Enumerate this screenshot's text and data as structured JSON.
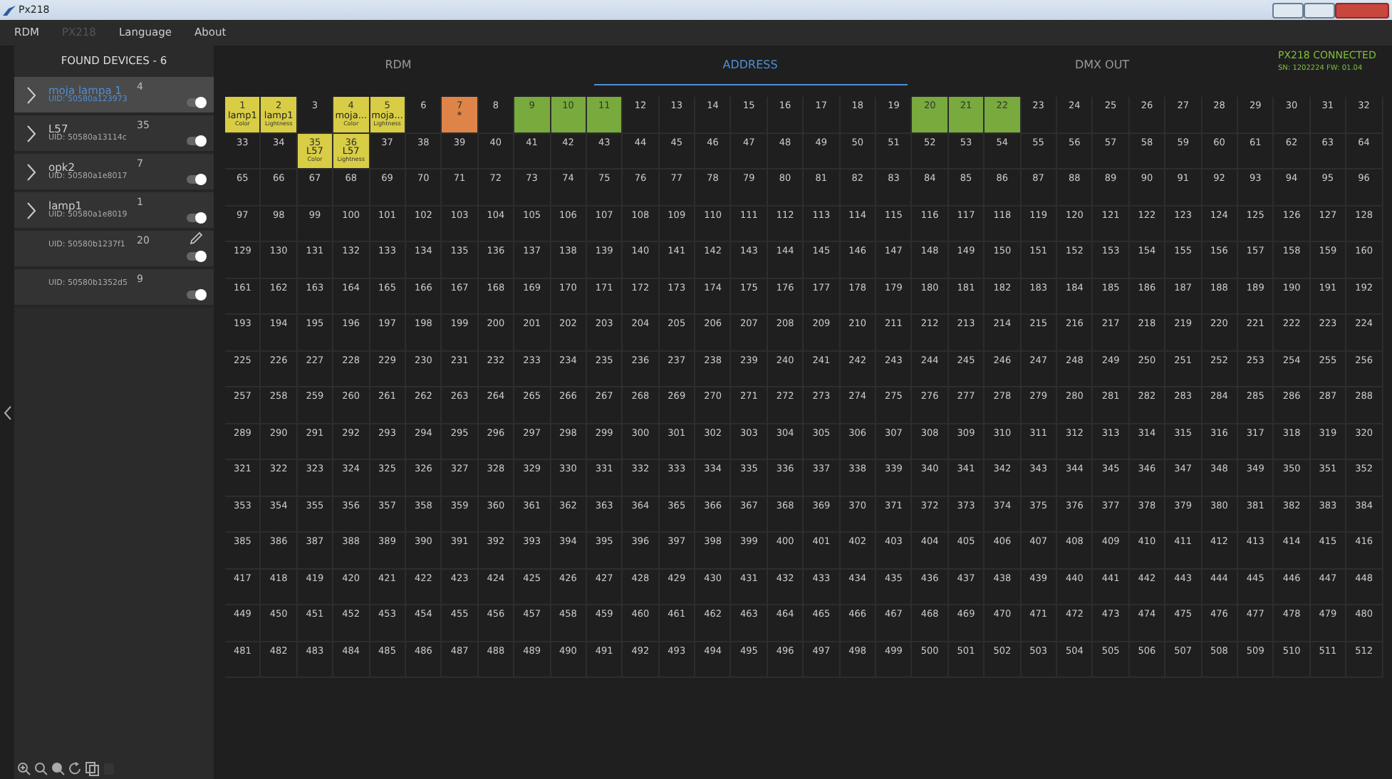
{
  "window": {
    "title": "Px218"
  },
  "menu": [
    {
      "label": "RDM",
      "disabled": false
    },
    {
      "label": "PX218",
      "disabled": true
    },
    {
      "label": "Language",
      "disabled": false
    },
    {
      "label": "About",
      "disabled": false
    }
  ],
  "sidebar": {
    "title": "FOUND DEVICES - 6",
    "devices": [
      {
        "name": "moja lampa 1",
        "uid": "UID: 50580a123973",
        "address": "4",
        "expandable": true,
        "selected": true,
        "on": true,
        "editable": false
      },
      {
        "name": "L57",
        "uid": "UID: 50580a13114c",
        "address": "35",
        "expandable": true,
        "selected": false,
        "on": true,
        "editable": false
      },
      {
        "name": "opk2",
        "uid": "UID: 50580a1e8017",
        "address": "7",
        "expandable": true,
        "selected": false,
        "on": true,
        "editable": false
      },
      {
        "name": "lamp1",
        "uid": "UID: 50580a1e8019",
        "address": "1",
        "expandable": true,
        "selected": false,
        "on": true,
        "editable": false
      },
      {
        "uid": "UID: 50580b1237f1",
        "address": "20",
        "expandable": false,
        "selected": false,
        "on": true,
        "editable": true
      },
      {
        "uid": "UID: 50580b1352d5",
        "address": "9",
        "expandable": false,
        "selected": false,
        "on": true,
        "editable": false
      }
    ],
    "tools": [
      {
        "kind": "zoom-in",
        "disabled": false
      },
      {
        "kind": "zoom-out",
        "disabled": false
      },
      {
        "kind": "zoom-fit",
        "disabled": false
      },
      {
        "kind": "rotate",
        "disabled": false
      },
      {
        "kind": "copy",
        "disabled": false
      },
      {
        "kind": "paste",
        "disabled": true
      }
    ]
  },
  "tabs": [
    {
      "label": "RDM",
      "selected": false
    },
    {
      "label": "ADDRESS",
      "selected": true
    },
    {
      "label": "DMX OUT",
      "selected": false
    }
  ],
  "status": {
    "connection": "PX218 CONNECTED",
    "info": "SN: 1202224 FW: 01.04"
  },
  "grid": {
    "rows": [
      [
        {
          "number": "1",
          "device": "lamp1",
          "param": "Color",
          "color": "#d8cd45"
        },
        {
          "number": "2",
          "device": "lamp1",
          "param": "Lightness",
          "color": "#d8cd45"
        },
        "3",
        {
          "number": "4",
          "device": "moja...",
          "param": "Color",
          "color": "#d8cd45"
        },
        {
          "number": "5",
          "device": "moja...",
          "param": "Lightness",
          "color": "#d8cd45"
        },
        "6",
        {
          "number": "7",
          "device": "*",
          "color": "#de8449"
        },
        "8",
        {
          "number": "9",
          "color": "#78aa3d"
        },
        {
          "number": "10",
          "color": "#78aa3d"
        },
        {
          "number": "11",
          "color": "#78aa3d"
        },
        "12",
        "13",
        "14",
        "15",
        "16",
        "17",
        "18",
        "19",
        {
          "number": "20",
          "color": "#78aa3d"
        },
        {
          "number": "21",
          "color": "#78aa3d"
        },
        {
          "number": "22",
          "color": "#78aa3d"
        },
        "23",
        "24",
        "25",
        "26",
        "27",
        "28",
        "29",
        "30",
        "31",
        "32"
      ],
      [
        "33",
        "34",
        {
          "number": "35",
          "device": "L57",
          "param": "Color",
          "color": "#d8cd45"
        },
        {
          "number": "36",
          "device": "L57",
          "param": "Lightness",
          "color": "#d8cd45"
        },
        "37",
        "38",
        "39",
        "40",
        "41",
        "42",
        "43",
        "44",
        "45",
        "46",
        "47",
        "48",
        "49",
        "50",
        "51",
        "52",
        "53",
        "54",
        "55",
        "56",
        "57",
        "58",
        "59",
        "60",
        "61",
        "62",
        "63",
        "64"
      ],
      [
        "65",
        "66",
        "67",
        "68",
        "69",
        "70",
        "71",
        "72",
        "73",
        "74",
        "75",
        "76",
        "77",
        "78",
        "79",
        "80",
        "81",
        "82",
        "83",
        "84",
        "85",
        "86",
        "87",
        "88",
        "89",
        "90",
        "91",
        "92",
        "93",
        "94",
        "95",
        "96"
      ],
      [
        "97",
        "98",
        "99",
        "100",
        "101",
        "102",
        "103",
        "104",
        "105",
        "106",
        "107",
        "108",
        "109",
        "110",
        "111",
        "112",
        "113",
        "114",
        "115",
        "116",
        "117",
        "118",
        "119",
        "120",
        "121",
        "122",
        "123",
        "124",
        "125",
        "126",
        "127",
        "128"
      ],
      [
        "129",
        "130",
        "131",
        "132",
        "133",
        "134",
        "135",
        "136",
        "137",
        "138",
        "139",
        "140",
        "141",
        "142",
        "143",
        "144",
        "145",
        "146",
        "147",
        "148",
        "149",
        "150",
        "151",
        "152",
        "153",
        "154",
        "155",
        "156",
        "157",
        "158",
        "159",
        "160"
      ],
      [
        "161",
        "162",
        "163",
        "164",
        "165",
        "166",
        "167",
        "168",
        "169",
        "170",
        "171",
        "172",
        "173",
        "174",
        "175",
        "176",
        "177",
        "178",
        "179",
        "180",
        "181",
        "182",
        "183",
        "184",
        "185",
        "186",
        "187",
        "188",
        "189",
        "190",
        "191",
        "192"
      ],
      [
        "193",
        "194",
        "195",
        "196",
        "197",
        "198",
        "199",
        "200",
        "201",
        "202",
        "203",
        "204",
        "205",
        "206",
        "207",
        "208",
        "209",
        "210",
        "211",
        "212",
        "213",
        "214",
        "215",
        "216",
        "217",
        "218",
        "219",
        "220",
        "221",
        "222",
        "223",
        "224"
      ],
      [
        "225",
        "226",
        "227",
        "228",
        "229",
        "230",
        "231",
        "232",
        "233",
        "234",
        "235",
        "236",
        "237",
        "238",
        "239",
        "240",
        "241",
        "242",
        "243",
        "244",
        "245",
        "246",
        "247",
        "248",
        "249",
        "250",
        "251",
        "252",
        "253",
        "254",
        "255",
        "256"
      ],
      [
        "257",
        "258",
        "259",
        "260",
        "261",
        "262",
        "263",
        "264",
        "265",
        "266",
        "267",
        "268",
        "269",
        "270",
        "271",
        "272",
        "273",
        "274",
        "275",
        "276",
        "277",
        "278",
        "279",
        "280",
        "281",
        "282",
        "283",
        "284",
        "285",
        "286",
        "287",
        "288"
      ],
      [
        "289",
        "290",
        "291",
        "292",
        "293",
        "294",
        "295",
        "296",
        "297",
        "298",
        "299",
        "300",
        "301",
        "302",
        "303",
        "304",
        "305",
        "306",
        "307",
        "308",
        "309",
        "310",
        "311",
        "312",
        "313",
        "314",
        "315",
        "316",
        "317",
        "318",
        "319",
        "320"
      ],
      [
        "321",
        "322",
        "323",
        "324",
        "325",
        "326",
        "327",
        "328",
        "329",
        "330",
        "331",
        "332",
        "333",
        "334",
        "335",
        "336",
        "337",
        "338",
        "339",
        "340",
        "341",
        "342",
        "343",
        "344",
        "345",
        "346",
        "347",
        "348",
        "349",
        "350",
        "351",
        "352"
      ],
      [
        "353",
        "354",
        "355",
        "356",
        "357",
        "358",
        "359",
        "360",
        "361",
        "362",
        "363",
        "364",
        "365",
        "366",
        "367",
        "368",
        "369",
        "370",
        "371",
        "372",
        "373",
        "374",
        "375",
        "376",
        "377",
        "378",
        "379",
        "380",
        "381",
        "382",
        "383",
        "384"
      ],
      [
        "385",
        "386",
        "387",
        "388",
        "389",
        "390",
        "391",
        "392",
        "393",
        "394",
        "395",
        "396",
        "397",
        "398",
        "399",
        "400",
        "401",
        "402",
        "403",
        "404",
        "405",
        "406",
        "407",
        "408",
        "409",
        "410",
        "411",
        "412",
        "413",
        "414",
        "415",
        "416"
      ],
      [
        "417",
        "418",
        "419",
        "420",
        "421",
        "422",
        "423",
        "424",
        "425",
        "426",
        "427",
        "428",
        "429",
        "430",
        "431",
        "432",
        "433",
        "434",
        "435",
        "436",
        "437",
        "438",
        "439",
        "440",
        "441",
        "442",
        "443",
        "444",
        "445",
        "446",
        "447",
        "448"
      ],
      [
        "449",
        "450",
        "451",
        "452",
        "453",
        "454",
        "455",
        "456",
        "457",
        "458",
        "459",
        "460",
        "461",
        "462",
        "463",
        "464",
        "465",
        "466",
        "467",
        "468",
        "469",
        "470",
        "471",
        "472",
        "473",
        "474",
        "475",
        "476",
        "477",
        "478",
        "479",
        "480"
      ],
      [
        "481",
        "482",
        "483",
        "484",
        "485",
        "486",
        "487",
        "488",
        "489",
        "490",
        "491",
        "492",
        "493",
        "494",
        "495",
        "496",
        "497",
        "498",
        "499",
        "500",
        "501",
        "502",
        "503",
        "504",
        "505",
        "506",
        "507",
        "508",
        "509",
        "510",
        "511",
        "512"
      ]
    ]
  }
}
